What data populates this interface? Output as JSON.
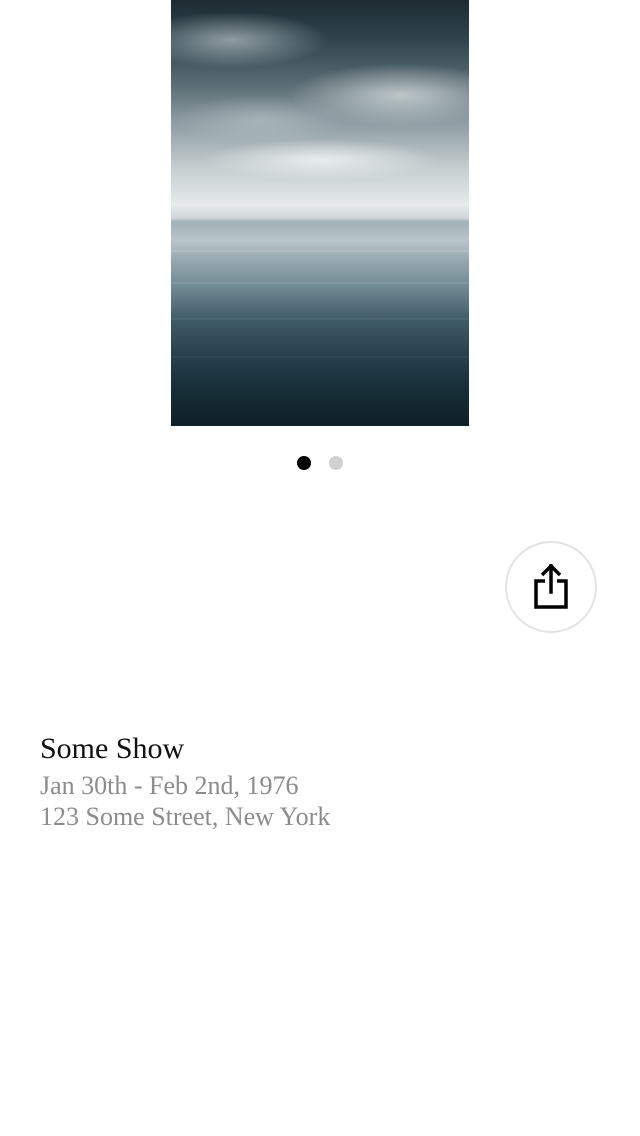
{
  "carousel": {
    "image_alt": "seascape-painting",
    "dots": [
      {
        "active": true
      },
      {
        "active": false
      }
    ]
  },
  "share": {
    "icon": "share-icon"
  },
  "show": {
    "title": "Some Show",
    "dates": "Jan 30th - Feb 2nd, 1976",
    "address": "123 Some Street, New York"
  },
  "colors": {
    "title": "#111111",
    "secondary_text": "#8c8c8c",
    "dot_active": "#000000",
    "dot_inactive": "#d0d0d0",
    "share_border": "#e3e3e3"
  }
}
